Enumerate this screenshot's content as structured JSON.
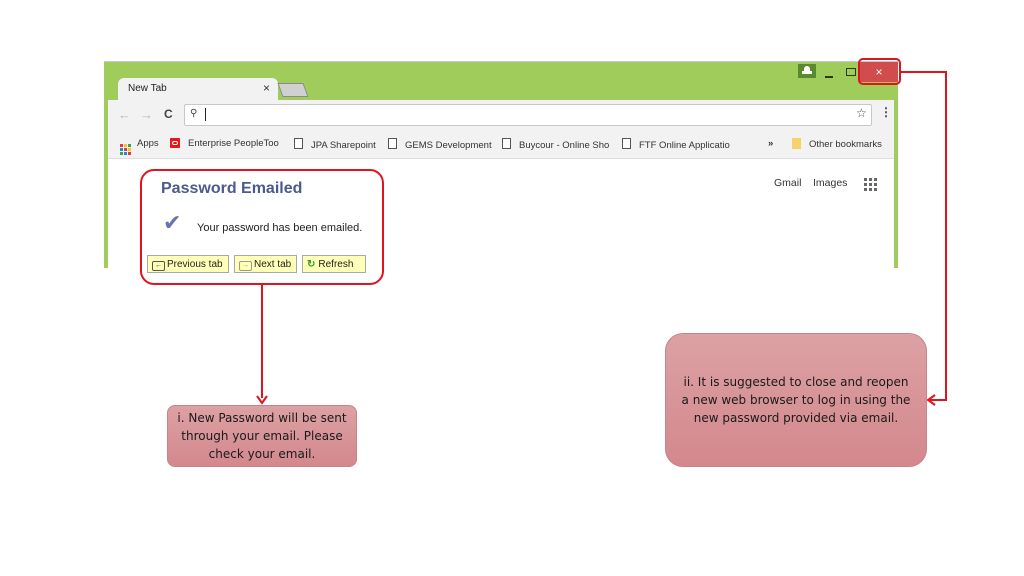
{
  "browser": {
    "tab_title": "New Tab",
    "tab_close": "×",
    "window_controls": {
      "user": "user-icon",
      "minimize": "minimize-icon",
      "maximize": "maximize-icon",
      "close": "×"
    },
    "nav": {
      "back": "←",
      "forward": "→",
      "reload": "C"
    },
    "omnibox": {
      "search_icon": "⚲",
      "value": ""
    },
    "star": "☆",
    "menu": "⋮",
    "bookmarks": [
      {
        "label": "Apps",
        "icon": "apps-icon"
      },
      {
        "label": "Enterprise PeopleToo",
        "icon": "oracle-icon"
      },
      {
        "label": "JPA Sharepoint",
        "icon": "page-icon"
      },
      {
        "label": "GEMS Development",
        "icon": "page-icon"
      },
      {
        "label": "Buycour - Online Sho",
        "icon": "page-icon"
      },
      {
        "label": "FTF Online Applicatio",
        "icon": "page-icon"
      }
    ],
    "overflow": "»",
    "other_bookmarks": "Other bookmarks",
    "google_links": {
      "gmail": "Gmail",
      "images": "Images"
    }
  },
  "panel": {
    "title": "Password Emailed",
    "check": "✔",
    "message": "Your password has been emailed.",
    "buttons": {
      "previous": "Previous tab",
      "next": "Next tab",
      "refresh": "Refresh"
    }
  },
  "callouts": {
    "one": "i. New Password will be sent through your email. Please check your email.",
    "two": "ii. It is suggested to close and reopen a new web browser to log in using the new password provided via email."
  },
  "colors": {
    "highlight": "#e0141e",
    "chrome_frame": "#9fcc5a",
    "callout": "#d7949a",
    "close_button": "#d14c4c"
  }
}
